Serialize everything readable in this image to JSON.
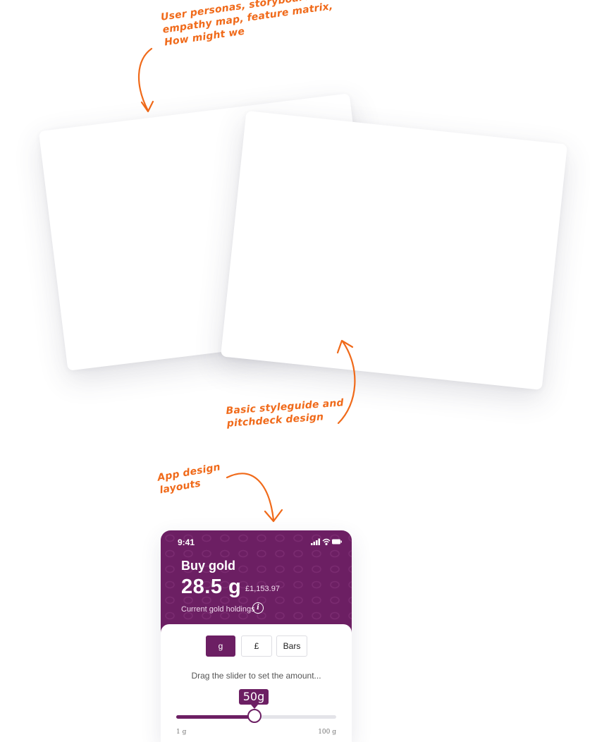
{
  "annotations": {
    "research": [
      "User personas, storyboards,",
      "empathy map, feature matrix,",
      "How might we"
    ],
    "styleguide": [
      "Basic styleguide and",
      "pitchdeck design"
    ],
    "app": [
      "App design",
      "layouts"
    ]
  },
  "phone": {
    "status_time": "9:41",
    "title": "Buy gold",
    "amount": "28.5 g",
    "price": "£1,153.97",
    "holdings_label": "Current gold holdings",
    "info_glyph": "i",
    "units": [
      {
        "label": "g",
        "active": true
      },
      {
        "label": "£",
        "active": false
      },
      {
        "label": "Bars",
        "active": false
      }
    ],
    "hint": "Drag the slider to set the amount...",
    "slider": {
      "value_label": "50g",
      "fraction": 0.49,
      "min_label": "1 g",
      "max_label": "100 g"
    }
  },
  "colors": {
    "accent": "#f06a1a",
    "brand": "#6c1f63"
  }
}
